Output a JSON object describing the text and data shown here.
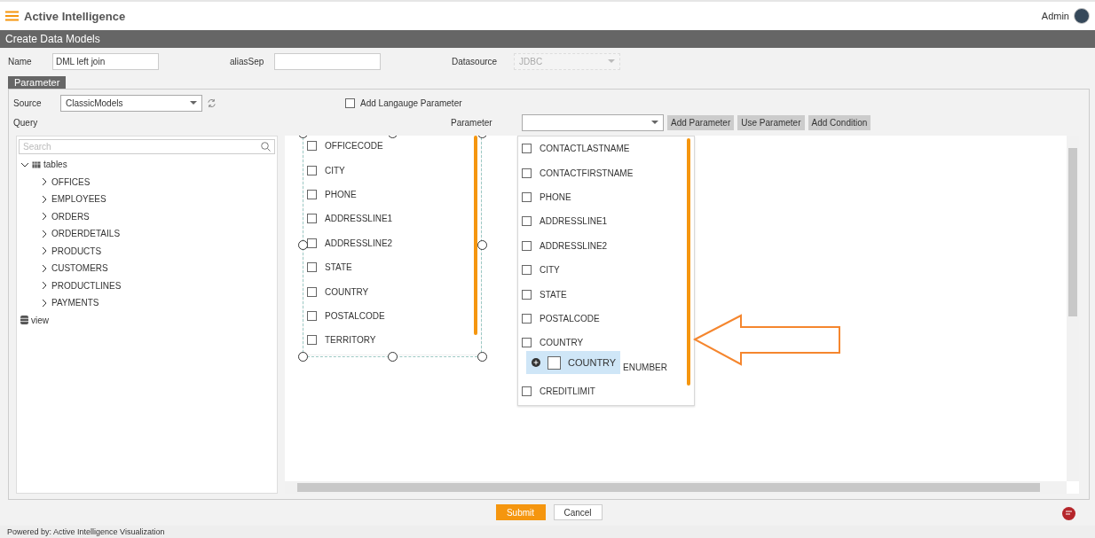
{
  "header": {
    "app_title": "Active Intelligence",
    "user": "Admin"
  },
  "page_title": "Create Data Models",
  "form": [
    {
      "label": "Name",
      "value": "DML left join",
      "kind": "input"
    },
    {
      "label": "aliasSep",
      "kind": "input"
    },
    {
      "label": "Datasource",
      "value": "JDBC",
      "kind": "select",
      "disabled": true
    }
  ],
  "parameter_tab": {
    "label": "Parameter"
  },
  "source": {
    "label": "Source",
    "value": "ClassicModels"
  },
  "add_language_parameter": {
    "label": "Add Langauge Parameter",
    "checked": false
  },
  "query_label": "Query",
  "parameter": {
    "label": "Parameter"
  },
  "buttons": [
    "Add Parameter",
    "Use Parameter",
    "Add Condition"
  ],
  "search": {
    "placeholder": "Search"
  },
  "tree": [
    {
      "label": "tables",
      "kind": "tables",
      "expanded": true,
      "children": [
        {
          "label": "OFFICES",
          "expanded": false
        },
        {
          "label": "EMPLOYEES",
          "expanded": false
        },
        {
          "label": "ORDERS",
          "expanded": false
        },
        {
          "label": "ORDERDETAILS",
          "expanded": false
        },
        {
          "label": "PRODUCTS",
          "expanded": false
        },
        {
          "label": "CUSTOMERS",
          "expanded": false
        },
        {
          "label": "PRODUCTLINES",
          "expanded": false
        },
        {
          "label": "PAYMENTS",
          "expanded": false
        }
      ]
    },
    {
      "label": "view",
      "kind": "view"
    }
  ],
  "canvas_tables": [
    {
      "selected": true,
      "fields": [
        {
          "label": "OFFICECODE",
          "checked": false
        },
        {
          "label": "CITY",
          "checked": false
        },
        {
          "label": "PHONE",
          "checked": false
        },
        {
          "label": "ADDRESSLINE1",
          "checked": false
        },
        {
          "label": "ADDRESSLINE2",
          "checked": false
        },
        {
          "label": "STATE",
          "checked": false
        },
        {
          "label": "COUNTRY",
          "checked": false
        },
        {
          "label": "POSTALCODE",
          "checked": false
        },
        {
          "label": "TERRITORY",
          "checked": false
        }
      ]
    },
    {
      "selected": false,
      "fields": [
        {
          "label": "CONTACTLASTNAME",
          "checked": false
        },
        {
          "label": "CONTACTFIRSTNAME",
          "checked": false
        },
        {
          "label": "PHONE",
          "checked": false
        },
        {
          "label": "ADDRESSLINE1",
          "checked": false
        },
        {
          "label": "ADDRESSLINE2",
          "checked": false
        },
        {
          "label": "CITY",
          "checked": false
        },
        {
          "label": "STATE",
          "checked": false
        },
        {
          "label": "POSTALCODE",
          "checked": false
        },
        {
          "label": "COUNTRY",
          "checked": false
        },
        {
          "label": "ENUMBER",
          "kind": "covered"
        },
        {
          "label": "CREDITLIMIT",
          "checked": false
        }
      ]
    }
  ],
  "drag_chip": {
    "label": "COUNTRY",
    "checked": false
  },
  "actions": [
    {
      "label": "Submit",
      "kind": "primary"
    },
    {
      "label": "Cancel",
      "kind": "secondary"
    }
  ],
  "footer": "Powered by: Active Intelligence Visualization"
}
